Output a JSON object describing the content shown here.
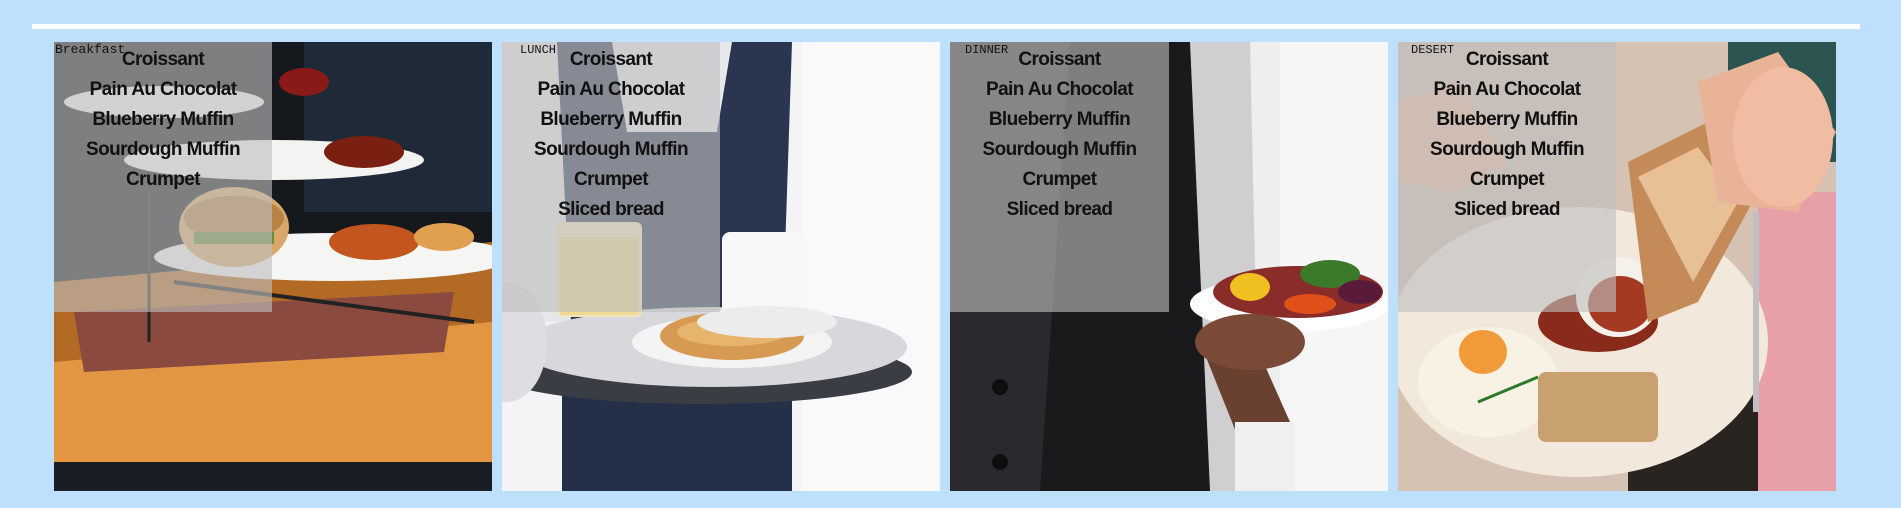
{
  "cards": [
    {
      "title": "Breakfast",
      "items": [
        "Croissant",
        "Pain Au Chocolat",
        "Blueberry Muffin",
        "Sourdough Muffin",
        "Crumpet"
      ]
    },
    {
      "title": "LUNCH",
      "items": [
        "Croissant",
        "Pain Au Chocolat",
        "Blueberry Muffin",
        "Sourdough Muffin",
        "Crumpet",
        "Sliced bread"
      ]
    },
    {
      "title": "DINNER",
      "items": [
        "Croissant",
        "Pain Au Chocolat",
        "Blueberry Muffin",
        "Sourdough Muffin",
        "Crumpet",
        "Sliced bread"
      ]
    },
    {
      "title": "DESERT",
      "items": [
        "Croissant",
        "Pain Au Chocolat",
        "Blueberry Muffin",
        "Sourdough Muffin",
        "Crumpet",
        "Sliced bread"
      ]
    }
  ],
  "colors": {
    "page_background": "#bfe0fc",
    "rule": "#ffffff",
    "overlay": "rgba(190,190,190,0.62)",
    "text": "#111111"
  }
}
